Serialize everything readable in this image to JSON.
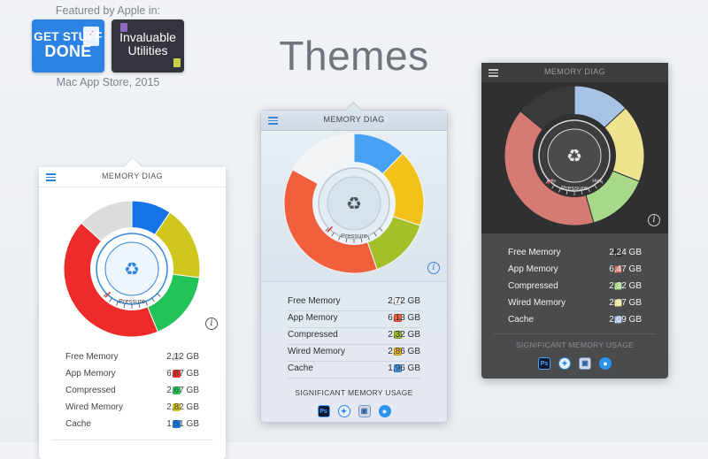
{
  "featured": {
    "caption_top": "Featured by Apple in:",
    "badge1": [
      "GET STUFF",
      "DONE"
    ],
    "badge2": [
      "Invaluable",
      "Utilities"
    ],
    "caption_bottom": "Mac App Store, 2015"
  },
  "page_title": "Themes",
  "panels": [
    {
      "header": "MEMORY DIAG",
      "gauge_label": "Pressure",
      "legend": [
        {
          "name": "Free Memory",
          "value": "2,12 GB",
          "color": "#dcdcdc"
        },
        {
          "name": "App Memory",
          "value": "6,87 GB",
          "color": "#ef2a2a"
        },
        {
          "name": "Compressed",
          "value": "2,67 GB",
          "color": "#22c45a"
        },
        {
          "name": "Wired Memory",
          "value": "2,82 GB",
          "color": "#cfc71e"
        },
        {
          "name": "Cache",
          "value": "1,51 GB",
          "color": "#1474e6"
        }
      ]
    },
    {
      "header": "MEMORY DIAG",
      "gauge_label": "Pressure",
      "legend": [
        {
          "name": "Free Memory",
          "value": "2,72 GB",
          "color": "#f2f4f6"
        },
        {
          "name": "App Memory",
          "value": "6,13 GB",
          "color": "#f0603c"
        },
        {
          "name": "Compressed",
          "value": "2,32 GB",
          "color": "#a3bf2a"
        },
        {
          "name": "Wired Memory",
          "value": "2,86 GB",
          "color": "#f3c21a"
        },
        {
          "name": "Cache",
          "value": "1,96 GB",
          "color": "#47a0f2"
        }
      ],
      "significant_label": "SIGNIFICANT MEMORY USAGE",
      "apps": [
        "Ps",
        "safari",
        "preview",
        "messages"
      ]
    },
    {
      "header": "MEMORY DIAG",
      "gauge_label": "Pressure",
      "gauge_low": "Low",
      "gauge_high": "High",
      "legend": [
        {
          "name": "Free Memory",
          "value": "2,24 GB",
          "color": "#3a3a3a"
        },
        {
          "name": "App Memory",
          "value": "6,47 GB",
          "color": "#d67a74"
        },
        {
          "name": "Compressed",
          "value": "2,32 GB",
          "color": "#a8d98a"
        },
        {
          "name": "Wired Memory",
          "value": "2,87 GB",
          "color": "#efe38f"
        },
        {
          "name": "Cache",
          "value": "2,09 GB",
          "color": "#a9c3e6"
        }
      ],
      "significant_label": "SIGNIFICANT MEMORY USAGE",
      "apps": [
        "Ps",
        "safari",
        "preview",
        "messages"
      ]
    }
  ]
}
